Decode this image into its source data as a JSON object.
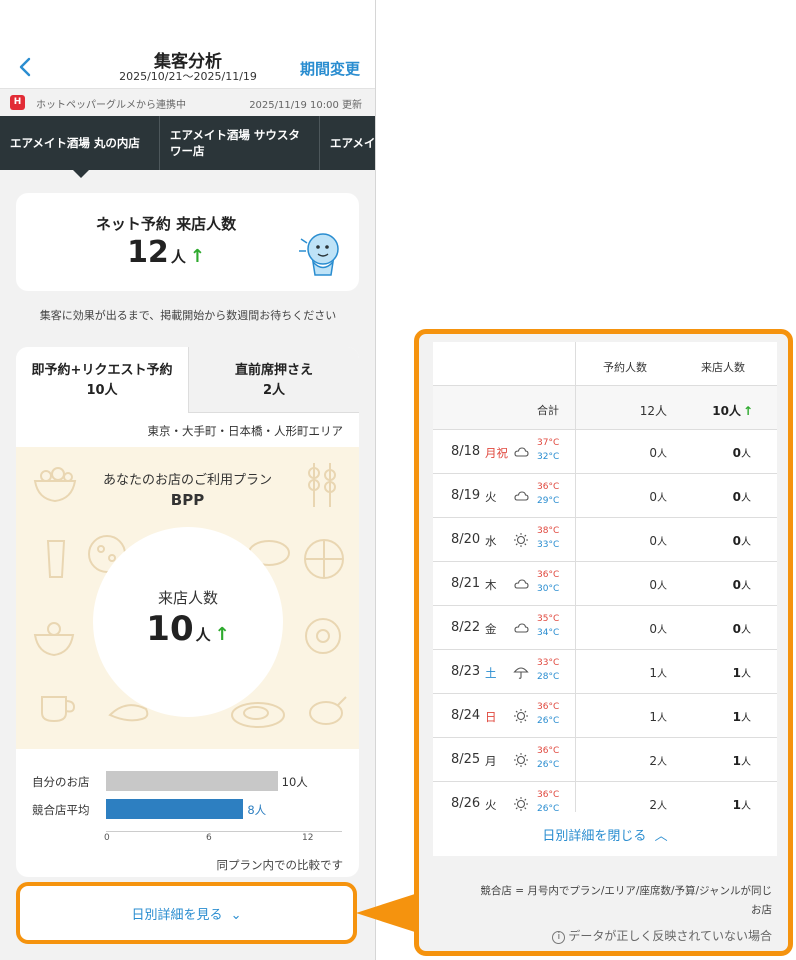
{
  "header": {
    "title": "集客分析",
    "period": "2025/10/21〜2025/11/19",
    "change_period": "期間変更"
  },
  "sync": {
    "logo": "H",
    "text": "ホットペッパーグルメから連携中",
    "updated": "2025/11/19 10:00 更新"
  },
  "store_tabs": [
    {
      "label": "エアメイト酒場 丸の内店"
    },
    {
      "label": "エアメイト酒場 サウスタワー店"
    },
    {
      "label": "エアメイ"
    }
  ],
  "net_reservation": {
    "label": "ネット予約 来店人数",
    "value": "12",
    "unit": "人",
    "trend": "↑"
  },
  "hint": "集客に効果が出るまで、掲載開始から数週間お待ちください",
  "panel_tabs": [
    {
      "title": "即予約+リクエスト予約",
      "value": "10人"
    },
    {
      "title": "直前席押さえ",
      "value": "2人"
    }
  ],
  "area": "東京・大手町・日本橋・人形町エリア",
  "plan": {
    "label": "あなたのお店のご利用プラン",
    "name": "BPP",
    "visit_label": "来店人数",
    "visit_value": "10",
    "unit": "人",
    "trend": "↑"
  },
  "chart_data": {
    "type": "bar",
    "orientation": "horizontal",
    "categories": [
      "自分のお店",
      "競合店平均"
    ],
    "values": [
      10,
      8
    ],
    "value_labels": [
      "10人",
      "8人"
    ],
    "colors": [
      "#c8c8c8",
      "#2d7fc1"
    ],
    "xlim": [
      0,
      12
    ],
    "ticks": [
      "0",
      "6",
      "12"
    ],
    "note": "同プラン内での比較です"
  },
  "detail_button": "日別詳細を見る",
  "chevron_down": "⌄",
  "table": {
    "col_reservations": "予約人数",
    "col_visits": "来店人数",
    "total_label": "合計",
    "total_reservations": "12人",
    "total_visits": "10人",
    "total_trend": "↑",
    "rows": [
      {
        "date": "8/18",
        "dow": "月祝",
        "dow_color": "#e0483e",
        "weather": "cloud-icon",
        "hi": "37°C",
        "lo": "32°C",
        "reservations": "0",
        "visits": "0",
        "unit": "人"
      },
      {
        "date": "8/19",
        "dow": "火",
        "dow_color": "#333333",
        "weather": "cloud-icon",
        "hi": "36°C",
        "lo": "29°C",
        "reservations": "0",
        "visits": "0",
        "unit": "人"
      },
      {
        "date": "8/20",
        "dow": "水",
        "dow_color": "#333333",
        "weather": "sun-icon",
        "hi": "38°C",
        "lo": "33°C",
        "reservations": "0",
        "visits": "0",
        "unit": "人"
      },
      {
        "date": "8/21",
        "dow": "木",
        "dow_color": "#333333",
        "weather": "cloud-icon",
        "hi": "36°C",
        "lo": "30°C",
        "reservations": "0",
        "visits": "0",
        "unit": "人"
      },
      {
        "date": "8/22",
        "dow": "金",
        "dow_color": "#333333",
        "weather": "cloud-icon",
        "hi": "35°C",
        "lo": "34°C",
        "reservations": "0",
        "visits": "0",
        "unit": "人"
      },
      {
        "date": "8/23",
        "dow": "土",
        "dow_color": "#2a8dd0",
        "weather": "umbrella-icon",
        "hi": "33°C",
        "lo": "28°C",
        "reservations": "1",
        "visits": "1",
        "unit": "人"
      },
      {
        "date": "8/24",
        "dow": "日",
        "dow_color": "#e0483e",
        "weather": "sun-icon",
        "hi": "36°C",
        "lo": "26°C",
        "reservations": "1",
        "visits": "1",
        "unit": "人"
      },
      {
        "date": "8/25",
        "dow": "月",
        "dow_color": "#333333",
        "weather": "sun-icon",
        "hi": "36°C",
        "lo": "26°C",
        "reservations": "2",
        "visits": "1",
        "unit": "人"
      },
      {
        "date": "8/26",
        "dow": "火",
        "dow_color": "#333333",
        "weather": "sun-icon",
        "hi": "36°C",
        "lo": "26°C",
        "reservations": "2",
        "visits": "1",
        "unit": "人"
      }
    ]
  },
  "close_button": "日別詳細を閉じる",
  "chevron_up": "︿",
  "competitor_note_line1": "競合店 = 月号内でプラン/エリア/座席数/予算/ジャンルが同じ",
  "competitor_note_line2": "お店",
  "data_warning": "データが正しく反映されていない場合",
  "colors": {
    "accent": "#2a8dd0",
    "highlight": "#f5930e",
    "trend_up": "#2eaa2e",
    "store_bar": "#2b3539",
    "plan_bg": "#fbf4e3"
  }
}
